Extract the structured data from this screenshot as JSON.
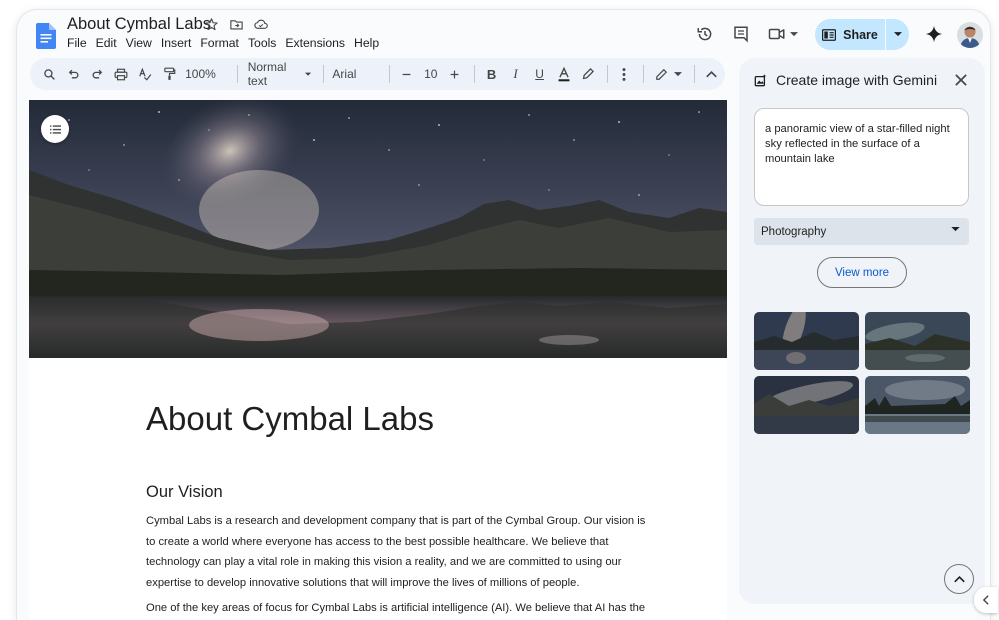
{
  "document": {
    "title": "About Cymbal Labs",
    "menu": [
      "File",
      "Edit",
      "View",
      "Insert",
      "Format",
      "Tools",
      "Extensions",
      "Help"
    ]
  },
  "header": {
    "share_label": "Share",
    "icons": [
      "history-icon",
      "comments-icon",
      "meet-icon",
      "gemini-icon",
      "avatar"
    ]
  },
  "toolbar": {
    "zoom": "100%",
    "style": "Normal text",
    "font": "Arial",
    "font_size": "10"
  },
  "content": {
    "heading": "About Cymbal Labs",
    "subheading": "Our Vision",
    "paragraph1_lines": [
      "Cymbal Labs is a research and development company that is part of the Cymbal Group. Our vision is",
      "to create a world where everyone has access to the best possible healthcare. We believe that",
      "technology can play a vital role in making this vision a reality, and we are committed to using our",
      "expertise to develop innovative solutions that will improve the lives of millions of people."
    ],
    "paragraph2": "One of the key areas of focus for Cymbal Labs is artificial intelligence (AI). We believe that AI has the"
  },
  "gemini_panel": {
    "title": "Create image with Gemini",
    "prompt": "a panoramic view of a star-filled night sky reflected in the surface of a mountain lake",
    "style_value": "Photography",
    "view_more_label": "View more"
  },
  "colors": {
    "share_bg": "#c2e7ff",
    "panel_bg": "#f0f4f9",
    "toolbar_bg": "#edf2fa",
    "link_blue": "#0b57d0",
    "docs_blue": "#4285f4"
  }
}
